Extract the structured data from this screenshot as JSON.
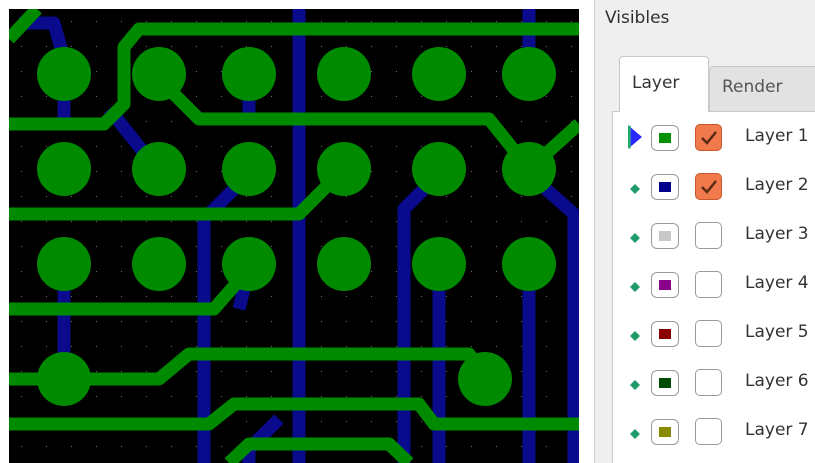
{
  "panel": {
    "title": "Visibles",
    "tabs": [
      {
        "label": "Layer",
        "active": true
      },
      {
        "label": "Render",
        "active": false
      }
    ]
  },
  "layers": [
    {
      "label": "Layer 1",
      "color": "#009200",
      "visible": true,
      "active": true
    },
    {
      "label": "Layer 2",
      "color": "#00008a",
      "visible": true,
      "active": false
    },
    {
      "label": "Layer 3",
      "color": "#c8c8c8",
      "visible": false,
      "active": false
    },
    {
      "label": "Layer 4",
      "color": "#8a008a",
      "visible": false,
      "active": false
    },
    {
      "label": "Layer 5",
      "color": "#8a0000",
      "visible": false,
      "active": false
    },
    {
      "label": "Layer 6",
      "color": "#004c00",
      "visible": false,
      "active": false
    },
    {
      "label": "Layer 7",
      "color": "#8a8a00",
      "visible": false,
      "active": false
    }
  ],
  "colors": {
    "board_background": "#000000",
    "copper_front": "#008a00",
    "copper_back": "#0a0a8c",
    "active_indicator": "#2a2aff",
    "inactive_indicator": "#1f9a6a",
    "checkbox_on": "#f07a4c"
  }
}
